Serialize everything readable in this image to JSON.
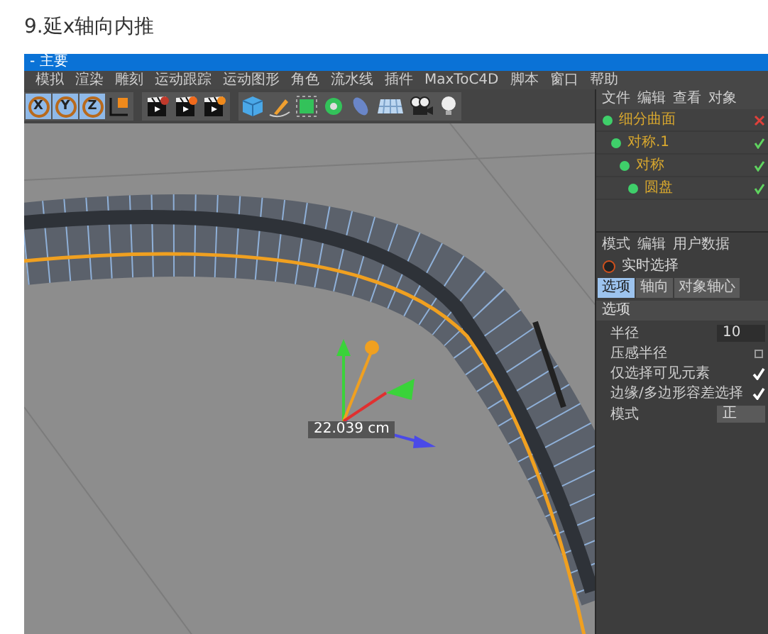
{
  "heading": "9.延x轴向内推",
  "window": {
    "title": "- 主要"
  },
  "menu": [
    "模拟",
    "渲染",
    "雕刻",
    "运动跟踪",
    "运动图形",
    "角色",
    "流水线",
    "插件",
    "MaxToC4D",
    "脚本",
    "窗口",
    "帮助"
  ],
  "axis_buttons": [
    {
      "label": "X",
      "selected": true
    },
    {
      "label": "Y",
      "selected": true
    },
    {
      "label": "Z",
      "selected": true
    }
  ],
  "viewport": {
    "measurement": "22.039 cm"
  },
  "object_manager": {
    "menu": [
      "文件",
      "编辑",
      "查看",
      "对象"
    ],
    "objects": [
      {
        "name": "细分曲面",
        "enabled": false,
        "children": [
          {
            "name": "对称.1",
            "enabled": true,
            "children": [
              {
                "name": "对称",
                "enabled": true,
                "children": [
                  {
                    "name": "圆盘",
                    "enabled": true
                  }
                ]
              }
            ]
          }
        ]
      }
    ]
  },
  "attributes": {
    "menu": [
      "模式",
      "编辑",
      "用户数据"
    ],
    "tool": "实时选择",
    "tabs": [
      {
        "label": "选项",
        "selected": true
      },
      {
        "label": "轴向",
        "selected": false
      },
      {
        "label": "对象轴心",
        "selected": false
      }
    ],
    "section": "选项",
    "fields": [
      {
        "kind": "number",
        "label": "半径",
        "value": "10"
      },
      {
        "kind": "checkbox",
        "label": "压感半径",
        "checked": false
      },
      {
        "kind": "checkbox",
        "label": "仅选择可见元素",
        "checked": true
      },
      {
        "kind": "checkbox",
        "label": "边缘/多边形容差选择",
        "checked": true
      },
      {
        "kind": "dropdown",
        "label": "模式",
        "value": "正"
      }
    ]
  }
}
